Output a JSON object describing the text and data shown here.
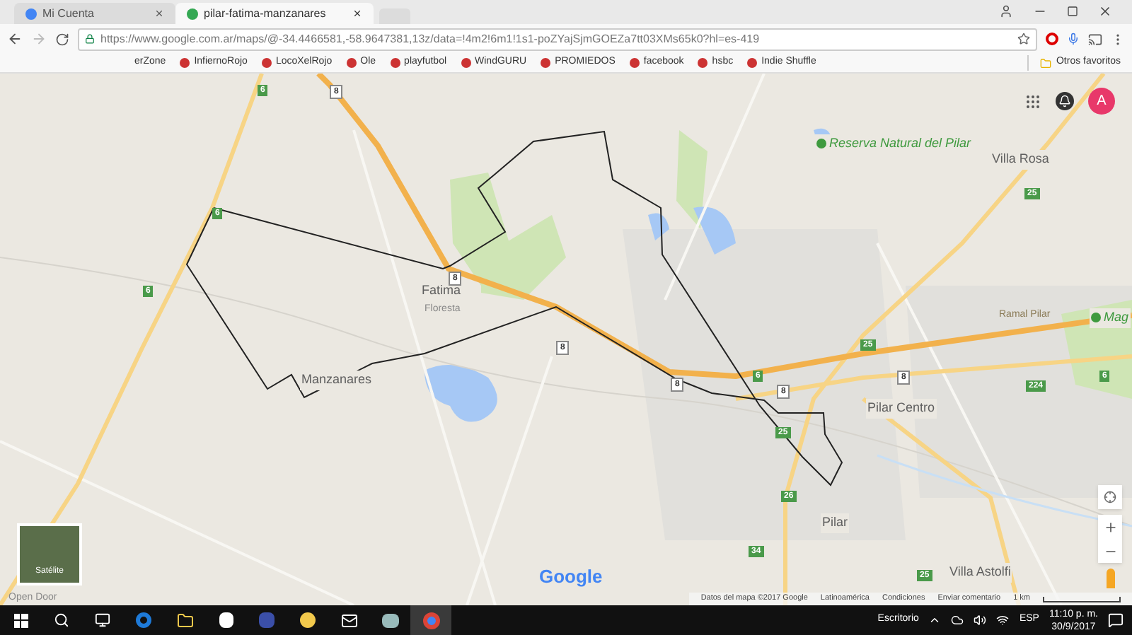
{
  "browser": {
    "tabs": [
      {
        "title": "Mi Cuenta",
        "selected": false
      },
      {
        "title": "pilar-fatima-manzanares",
        "selected": true
      }
    ],
    "address_bar": {
      "url": "https://www.google.com.ar/maps/@-34.4466581,-58.9647381,13z/data=!4m2!6m1!1s1-poZYajSjmGOEZa7tt03XMs65k0?hl=es-419"
    },
    "bookmarks": [
      {
        "label": "erZone"
      },
      {
        "label": "InfiernoRojo"
      },
      {
        "label": "LocoXelRojo"
      },
      {
        "label": "Ole"
      },
      {
        "label": "playfutbol"
      },
      {
        "label": "WindGURU"
      },
      {
        "label": "PROMIEDOS"
      },
      {
        "label": "facebook"
      },
      {
        "label": "hsbc"
      },
      {
        "label": "Indie Shuffle"
      }
    ],
    "other_bookmarks": "Otros favoritos"
  },
  "map": {
    "account_initial": "A",
    "places": [
      {
        "text": "Fatima",
        "kind": "town"
      },
      {
        "text": "Floresta",
        "kind": "area"
      },
      {
        "text": "Manzanares",
        "kind": "town"
      },
      {
        "text": "Pilar Centro",
        "kind": "town"
      },
      {
        "text": "Pilar",
        "kind": "town"
      },
      {
        "text": "Villa Rosa",
        "kind": "town"
      },
      {
        "text": "Villa Astolfi",
        "kind": "town"
      },
      {
        "text": "Reserva Natural del Pilar",
        "kind": "park"
      },
      {
        "text": "Mag",
        "kind": "park"
      },
      {
        "text": "Ramal Pilar",
        "kind": "road"
      },
      {
        "text": "Open Door",
        "kind": "area"
      }
    ],
    "shields": [
      {
        "text": "8"
      },
      {
        "text": "6"
      },
      {
        "text": "6"
      },
      {
        "text": "6"
      },
      {
        "text": "8"
      },
      {
        "text": "8"
      },
      {
        "text": "8"
      },
      {
        "text": "25"
      },
      {
        "text": "25"
      },
      {
        "text": "6"
      },
      {
        "text": "8"
      },
      {
        "text": "8"
      },
      {
        "text": "6"
      },
      {
        "text": "224"
      },
      {
        "text": "25"
      },
      {
        "text": "26"
      },
      {
        "text": "34"
      },
      {
        "text": "25"
      }
    ],
    "layer_thumbnail": "Satélite",
    "logo": "Google",
    "footer": [
      "Datos del mapa ©2017 Google",
      "Latinoamérica",
      "Condiciones",
      "Enviar comentario"
    ],
    "scale": "1 km"
  },
  "taskbar": {
    "desktop": "Escritorio",
    "language": "ESP",
    "time": "11:10 p. m.",
    "date": "30/9/2017"
  }
}
